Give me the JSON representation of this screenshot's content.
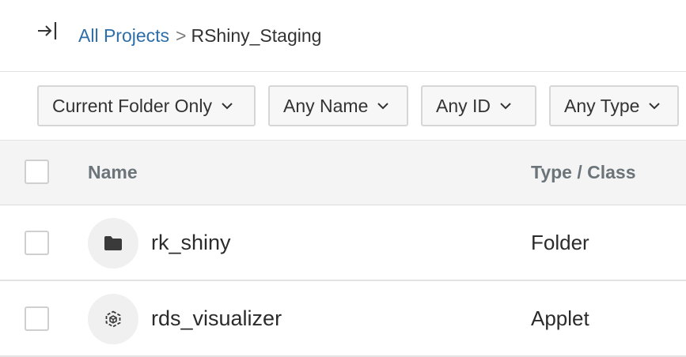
{
  "breadcrumb": {
    "root": "All Projects",
    "separator": ">",
    "current": "RShiny_Staging"
  },
  "filters": [
    {
      "label": "Current Folder Only"
    },
    {
      "label": "Any Name"
    },
    {
      "label": "Any ID"
    },
    {
      "label": "Any Type"
    }
  ],
  "table": {
    "columns": {
      "name": "Name",
      "type": "Type / Class"
    },
    "rows": [
      {
        "name": "rk_shiny",
        "type": "Folder",
        "icon": "folder-icon"
      },
      {
        "name": "rds_visualizer",
        "type": "Applet",
        "icon": "applet-icon"
      }
    ]
  },
  "colors": {
    "link": "#2d6ea8",
    "header_bg": "#f4f4f4",
    "header_text": "#6b7478",
    "border": "#e3e3e3"
  }
}
